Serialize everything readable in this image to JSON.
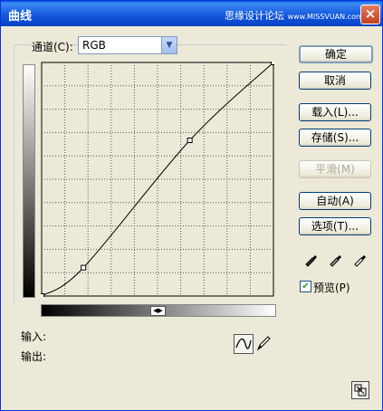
{
  "window": {
    "title": "曲线",
    "watermark_text": "思缘设计论坛",
    "watermark_url": "www.MISSVUAN.com",
    "close_label": "×"
  },
  "channel": {
    "label": "通道(C):",
    "value": "RGB"
  },
  "curve": {
    "points": [
      [
        0,
        0
      ],
      [
        46,
        31
      ],
      [
        163,
        170
      ],
      [
        255,
        255
      ]
    ],
    "grid_divisions": 10
  },
  "buttons": {
    "ok": "确定",
    "cancel": "取消",
    "load": "载入(L)...",
    "save": "存储(S)...",
    "smooth": "平滑(M)",
    "auto": "自动(A)",
    "options": "选项(T)..."
  },
  "preview": {
    "label": "预览(P)",
    "checked": true
  },
  "io": {
    "input_label": "输入:",
    "output_label": "输出:"
  }
}
